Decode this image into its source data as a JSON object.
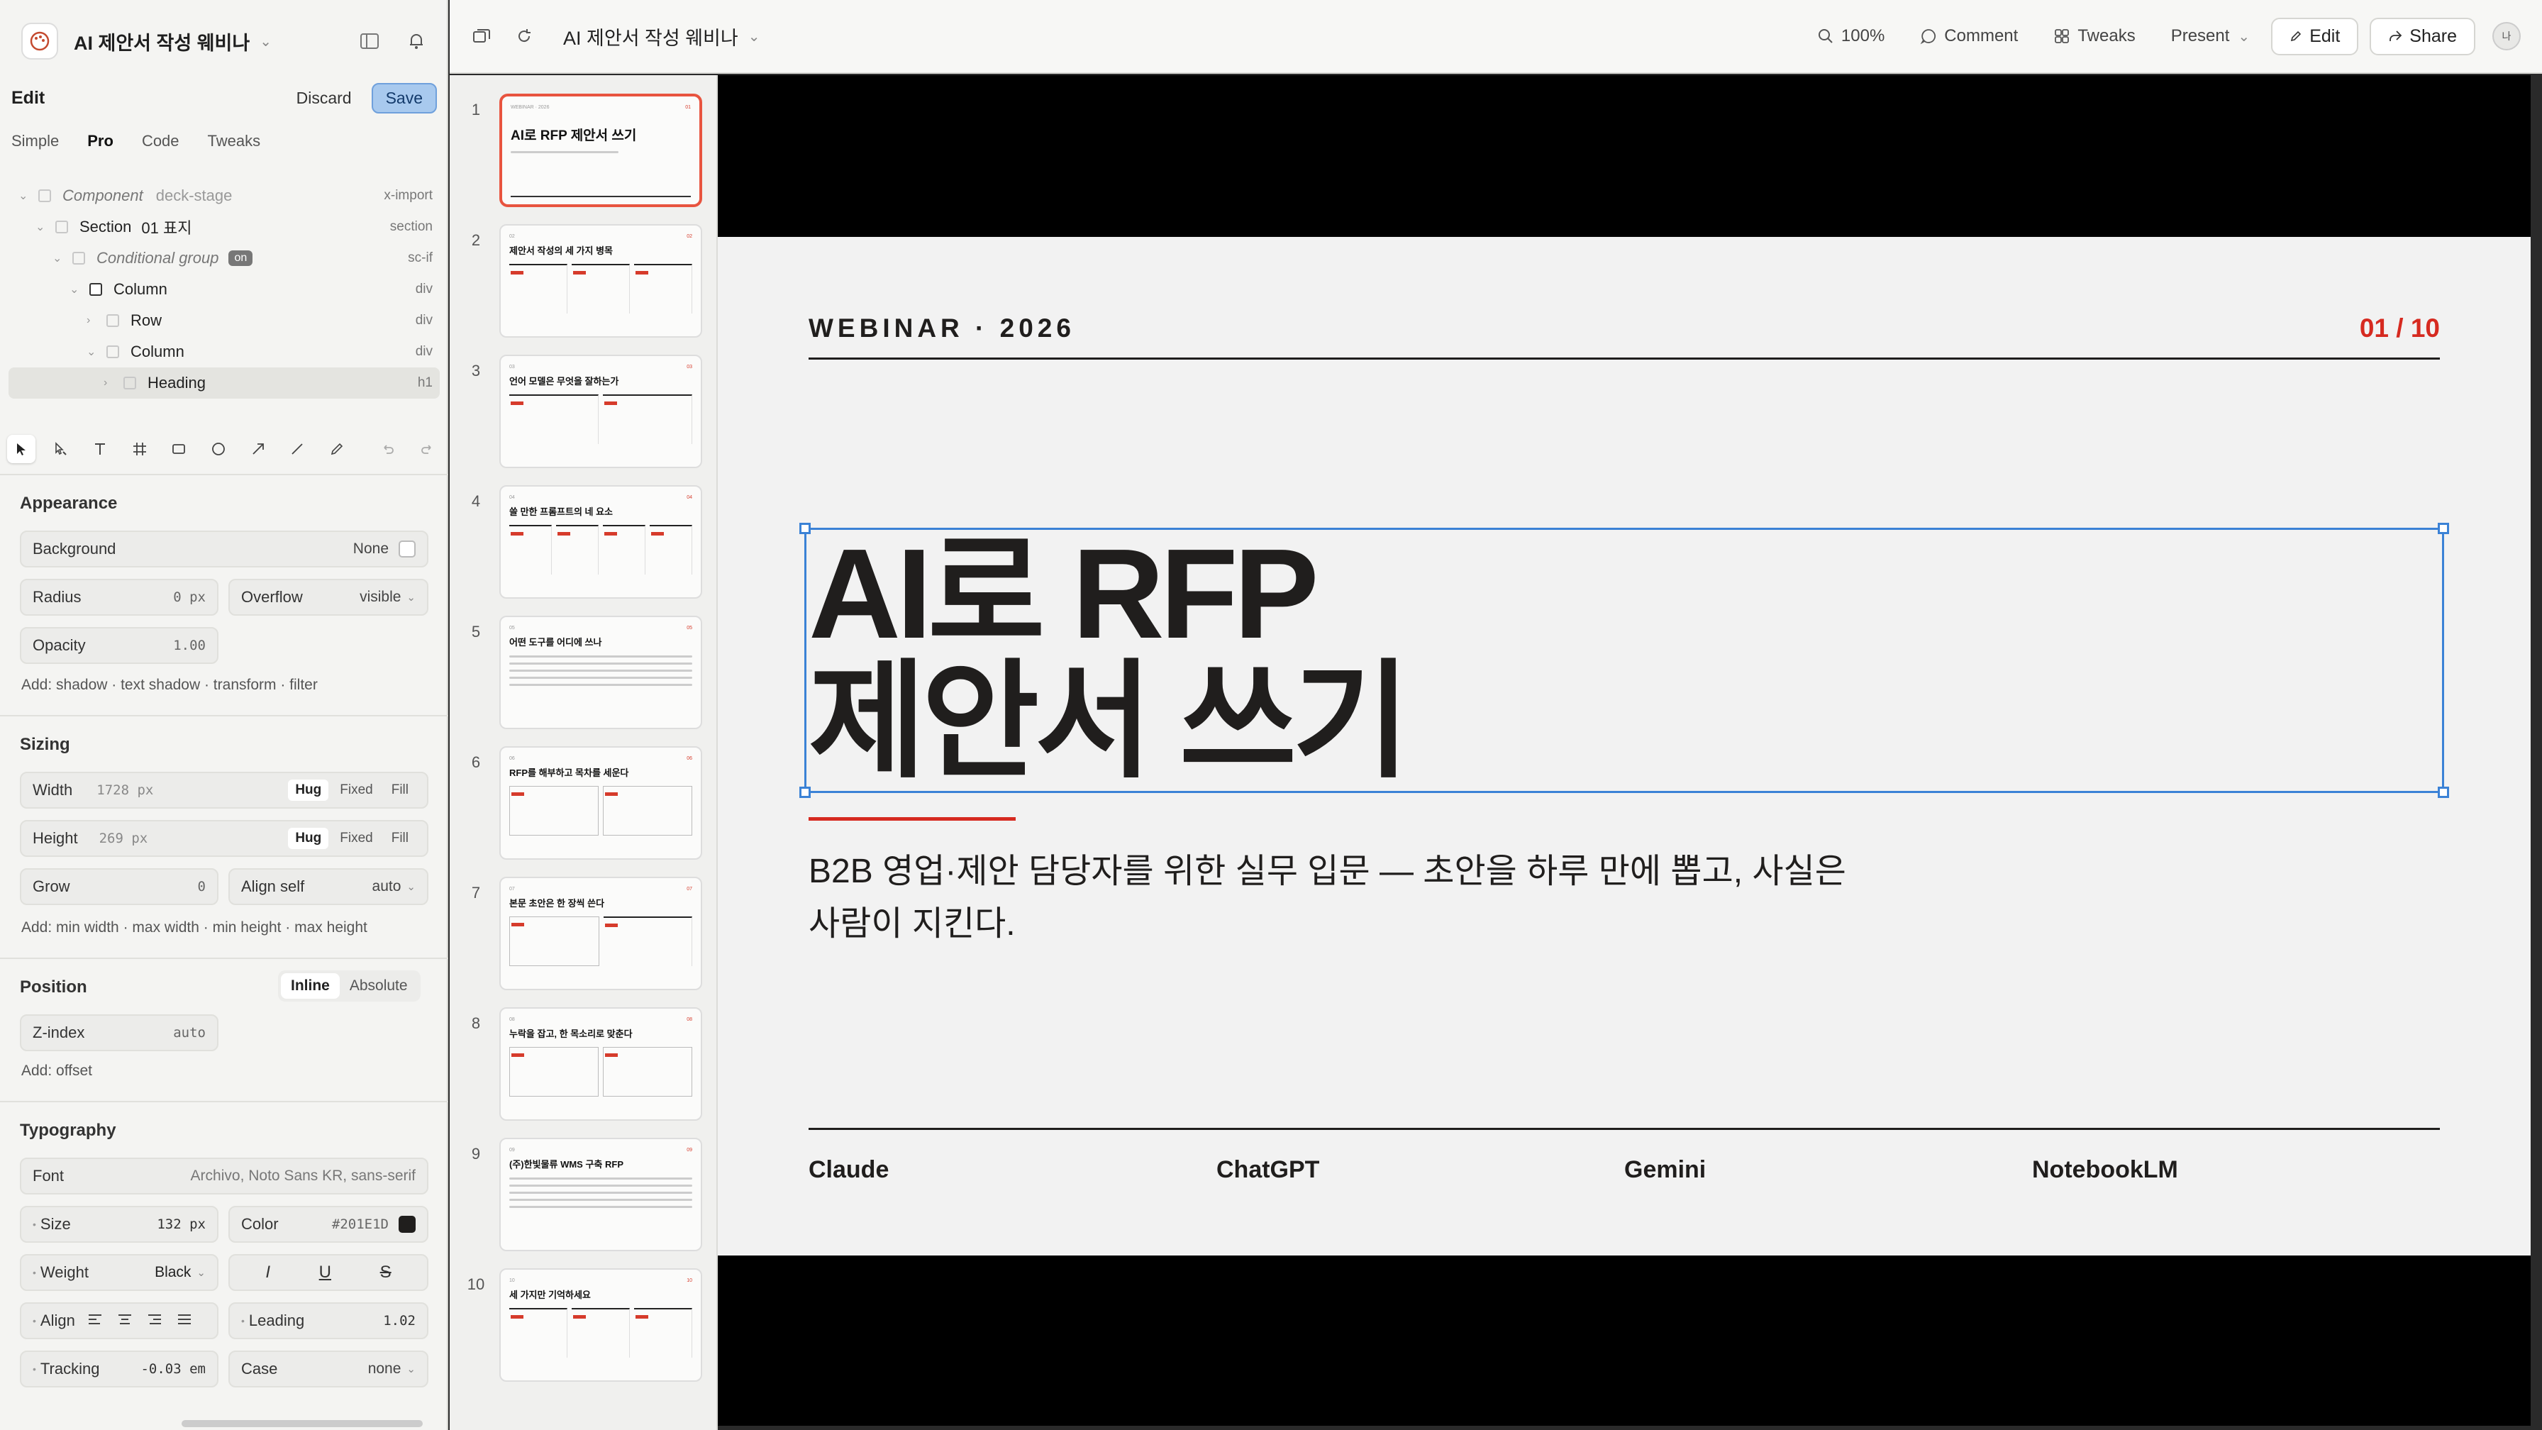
{
  "app": {
    "doc_title": "AI 제안서 작성 웨비나"
  },
  "edit": {
    "label": "Edit",
    "discard": "Discard",
    "save": "Save"
  },
  "mode_tabs": [
    "Simple",
    "Pro",
    "Code",
    "Tweaks"
  ],
  "tree": [
    {
      "name": "Component",
      "detail": "deck-stage",
      "tag": "x-import"
    },
    {
      "name": "Section",
      "detail": "01 표지",
      "tag": "section"
    },
    {
      "name": "Conditional group",
      "badge": "on",
      "tag": "sc-if"
    },
    {
      "name": "Column",
      "tag": "div"
    },
    {
      "name": "Row",
      "tag": "div"
    },
    {
      "name": "Column",
      "tag": "div"
    },
    {
      "name": "Heading",
      "tag": "h1"
    }
  ],
  "appearance": {
    "title": "Appearance",
    "background_label": "Background",
    "background_value": "None",
    "radius_label": "Radius",
    "radius_value": "0 px",
    "overflow_label": "Overflow",
    "overflow_value": "visible",
    "opacity_label": "Opacity",
    "opacity_value": "1.00",
    "add_hint": "Add: shadow · text shadow · transform · filter"
  },
  "sizing": {
    "title": "Sizing",
    "width_label": "Width",
    "width_value": "1728 px",
    "height_label": "Height",
    "height_value": "269 px",
    "modes": [
      "Hug",
      "Fixed",
      "Fill"
    ],
    "grow_label": "Grow",
    "grow_value": "0",
    "align_self_label": "Align self",
    "align_self_value": "auto",
    "add_hint": "Add: min width · max width · min height · max height"
  },
  "position": {
    "title": "Position",
    "modes": [
      "Inline",
      "Absolute"
    ],
    "zindex_label": "Z-index",
    "zindex_value": "auto",
    "add_hint": "Add: offset"
  },
  "typography": {
    "title": "Typography",
    "font_label": "Font",
    "font_value": "Archivo, Noto Sans KR, sans-serif",
    "size_label": "Size",
    "size_value": "132 px",
    "color_label": "Color",
    "color_value": "#201E1D",
    "weight_label": "Weight",
    "weight_value": "Black",
    "style_buttons": [
      "I",
      "U",
      "S"
    ],
    "align_label": "Align",
    "leading_label": "Leading",
    "leading_value": "1.02",
    "tracking_label": "Tracking",
    "tracking_value": "-0.03 em",
    "case_label": "Case",
    "case_value": "none"
  },
  "topbar": {
    "title": "AI 제안서 작성 웨비나",
    "zoom": "100%",
    "comment": "Comment",
    "tweaks": "Tweaks",
    "present": "Present",
    "edit": "Edit",
    "share": "Share",
    "avatar": "나"
  },
  "thumbnails": [
    {
      "num": "1",
      "title": "AI로 RFP 제안서 쓰기",
      "layout": "cover"
    },
    {
      "num": "2",
      "title": "제안서 작성의 세 가지 병목",
      "layout": "three-col"
    },
    {
      "num": "3",
      "title": "언어 모델은 무엇을 잘하는가",
      "layout": "two-col"
    },
    {
      "num": "4",
      "title": "쓸 만한 프롬프트의 네 요소",
      "layout": "four-col"
    },
    {
      "num": "5",
      "title": "어떤 도구를 어디에 쓰나",
      "layout": "table"
    },
    {
      "num": "6",
      "title": "RFP를 해부하고 목차를 세운다",
      "layout": "two-box"
    },
    {
      "num": "7",
      "title": "본문 초안은 한 장씩 쓴다",
      "layout": "two-col"
    },
    {
      "num": "8",
      "title": "누락을 잡고, 한 목소리로 맞춘다",
      "layout": "two-box"
    },
    {
      "num": "9",
      "title": "(주)한빛물류 WMS 구축 RFP",
      "layout": "table"
    },
    {
      "num": "10",
      "title": "세 가지만 기억하세요",
      "layout": "three-col"
    }
  ],
  "slide": {
    "kicker": "WEBINAR · 2026",
    "page": "01 / 10",
    "heading_line1": "AI로 RFP",
    "heading_line2": "제안서 쓰기",
    "subtitle": "B2B 영업·제안 담당자를 위한 실무 입문 — 초안을 하루 만에 뽑고, 사실은 사람이 지킨다.",
    "tools": [
      "Claude",
      "ChatGPT",
      "Gemini",
      "NotebookLM"
    ]
  },
  "colors": {
    "accent_red": "#d62a20",
    "ink": "#201e1d",
    "selection_blue": "#3b82d6",
    "save_blue": "#a8c9ee"
  }
}
